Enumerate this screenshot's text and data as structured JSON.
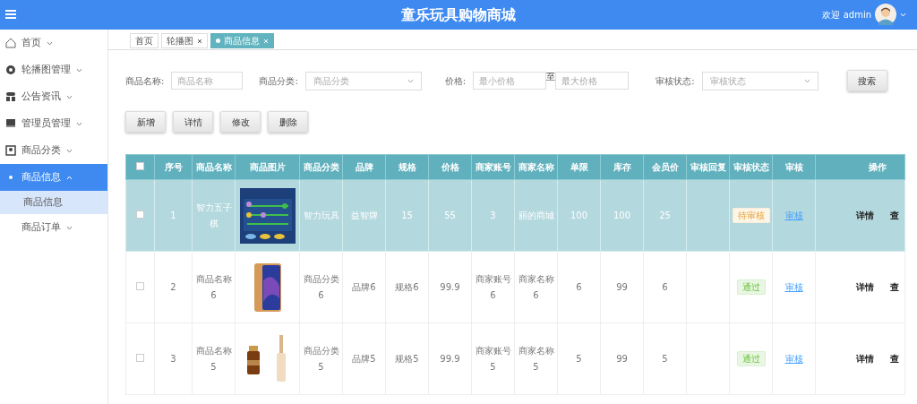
{
  "header": {
    "title": "童乐玩具购物商城",
    "welcome": "欢迎 admin"
  },
  "sidebar": {
    "items": [
      {
        "label": "首页",
        "expanded": false,
        "selected": false
      },
      {
        "label": "轮播图管理",
        "expanded": false,
        "selected": false
      },
      {
        "label": "公告资讯",
        "expanded": false,
        "selected": false
      },
      {
        "label": "管理员管理",
        "expanded": false,
        "selected": false
      },
      {
        "label": "商品分类",
        "expanded": false,
        "selected": false
      },
      {
        "label": "商品信息",
        "expanded": true,
        "selected": true,
        "children": [
          {
            "label": "商品信息",
            "selected": true
          }
        ]
      },
      {
        "label": "商品订单",
        "expanded": false,
        "selected": false
      }
    ]
  },
  "tabs": [
    {
      "label": "首页",
      "closable": false,
      "selected": false
    },
    {
      "label": "轮播图",
      "closable": true,
      "selected": false
    },
    {
      "label": "商品信息",
      "closable": true,
      "selected": true
    }
  ],
  "filters": [
    {
      "kind": "input",
      "label": "商品名称:",
      "placeholder": "商品名称"
    },
    {
      "kind": "select",
      "label": "商品分类:",
      "placeholder": "商品分类"
    },
    {
      "kind": "range",
      "label": "价格:",
      "placeholder": "最小价格",
      "separator": "至",
      "placeholder2": "最大价格"
    },
    {
      "kind": "select",
      "label": "审核状态:",
      "placeholder": "审核状态"
    }
  ],
  "search_button": "搜索",
  "actions": [
    "新增",
    "详情",
    "修改",
    "删除"
  ],
  "table": {
    "all_checked": false,
    "columns": [
      "序号",
      "商品名称",
      "商品图片",
      "商品分类",
      "品牌",
      "规格",
      "价格",
      "商家账号",
      "商家名称",
      "单限",
      "库存",
      "会员价",
      "审核回复",
      "审核状态",
      "审核",
      "操作"
    ],
    "rows": [
      {
        "selected": true,
        "checked": false,
        "cells": [
          "1",
          "智力五子棋",
          "",
          "智力玩具",
          "益智牌",
          "15",
          "55",
          "3",
          "丽的商城",
          "100",
          "100",
          "25",
          ""
        ],
        "status": {
          "text": "待审核",
          "kind": "pending"
        },
        "review": "审核",
        "ops": [
          "详情",
          "查"
        ]
      },
      {
        "selected": false,
        "checked": false,
        "cells": [
          "2",
          "商品名称6",
          "",
          "商品分类6",
          "品牌6",
          "规格6",
          "99.9",
          "商家账号6",
          "商家名称6",
          "6",
          "99",
          "6",
          ""
        ],
        "status": {
          "text": "通过",
          "kind": "passed"
        },
        "review": "审核",
        "ops": [
          "详情",
          "查"
        ]
      },
      {
        "selected": false,
        "checked": false,
        "cells": [
          "3",
          "商品名称5",
          "",
          "商品分类5",
          "品牌5",
          "规格5",
          "99.9",
          "商家账号5",
          "商家名称5",
          "5",
          "99",
          "5",
          ""
        ],
        "status": {
          "text": "通过",
          "kind": "passed"
        },
        "review": "审核",
        "ops": [
          "详情",
          "查"
        ]
      }
    ]
  }
}
